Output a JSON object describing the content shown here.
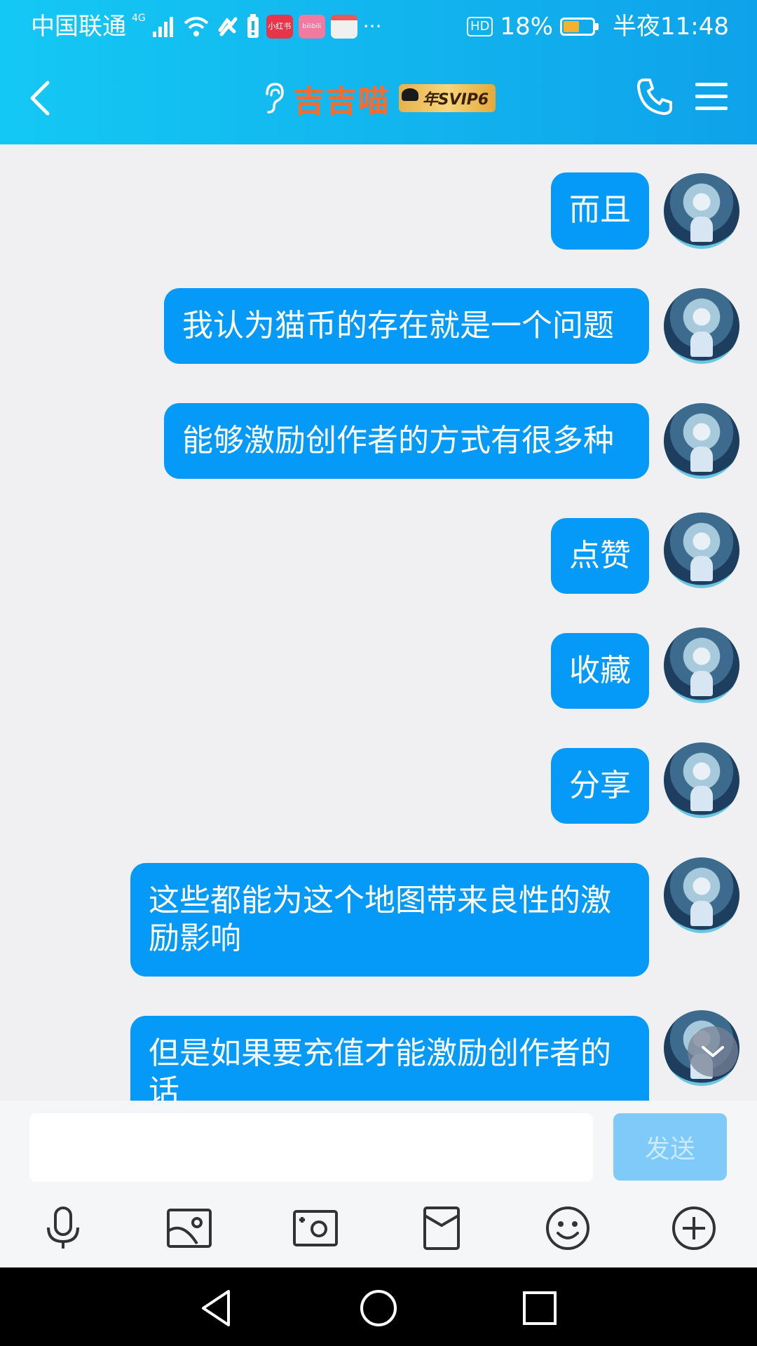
{
  "status_bar": {
    "carrier": "中国联通",
    "network": "4G",
    "app_badges": [
      {
        "label": "小红书",
        "color": "#e8344b"
      },
      {
        "label": "bilibili",
        "color": "#f27aa0"
      },
      {
        "label": "",
        "color": "#f0f0f0"
      }
    ],
    "more": "···",
    "hd": "HD",
    "battery": "18%",
    "battery_level": 0.18,
    "time": "半夜11:48"
  },
  "header": {
    "title": "吉吉喵",
    "badge": "年SVIP6",
    "title_color": "#ff6a2b",
    "background": "#12b4ee"
  },
  "messages": [
    {
      "text": "而且"
    },
    {
      "text": "我认为猫币的存在就是一个问题"
    },
    {
      "text": "能够激励创作者的方式有很多种"
    },
    {
      "text": "点赞"
    },
    {
      "text": "收藏"
    },
    {
      "text": "分享"
    },
    {
      "text": "这些都能为这个地图带来良性的激励影响"
    },
    {
      "text": "但是如果要充值才能激励创作者的话"
    }
  ],
  "input": {
    "value": "",
    "placeholder": "",
    "send_label": "发送"
  },
  "toolbar": {
    "icons": [
      "microphone-icon",
      "image-icon",
      "camera-icon",
      "red-packet-icon",
      "emoji-icon",
      "plus-icon"
    ]
  },
  "colors": {
    "bubble": "#0599f8",
    "chat_background": "#f0f0f2"
  }
}
